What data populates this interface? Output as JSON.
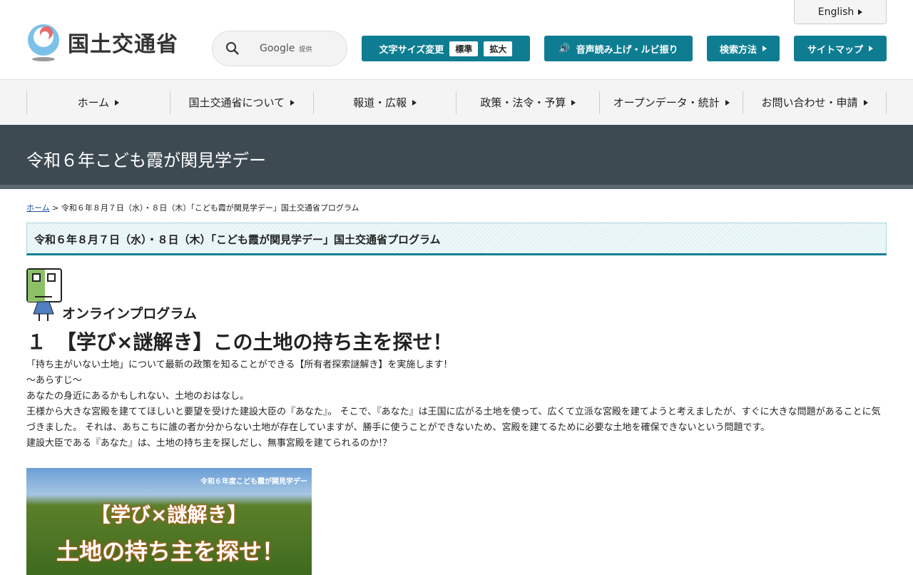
{
  "header": {
    "english": "English",
    "logo_text": "国土交通省",
    "search_brand": "Google",
    "search_provided": "提供",
    "font_size_label": "文字サイズ変更",
    "font_standard": "標準",
    "font_large": "拡大",
    "read_aloud": "音声読み上げ・ルビ振り",
    "search_method": "検索方法",
    "sitemap": "サイトマップ"
  },
  "nav": [
    "ホーム",
    "国土交通省について",
    "報道・広報",
    "政策・法令・予算",
    "オープンデータ・統計",
    "お問い合わせ・申請"
  ],
  "banner": "令和６年こども霞が関見学デー",
  "breadcrumb": {
    "home": "ホーム",
    "sep": " > ",
    "current": "令和６年８月７日（水）・８日（木）「こども霞が関見学デー」国土交通省プログラム"
  },
  "heading": "令和６年８月７日（水）・８日（木）「こども霞が関見学デー」国土交通省プログラム",
  "section": "オンラインプログラム",
  "program_title": "１　【学び×謎解き】この土地の持ち主を探せ！",
  "paragraphs": [
    "「持ち主がいない土地」について最新の政策を知ることができる【所有者探索謎解き】を実施します！",
    "～あらすじ～",
    "あなたの身近にあるかもしれない、土地のおはなし。",
    "王様から大きな宮殿を建ててほしいと要望を受けた建設大臣の『あなた』。 そこで、『あなた』は王国に広がる土地を使って、広くて立派な宮殿を建てようと考えましたが、すぐに大きな問題があることに気づきました。 それは、あちこちに誰の者か分からない土地が存在していますが、勝手に使うことができないため、宮殿を建てるために必要な土地を確保できないという問題です。",
    "建設大臣である『あなた』は、土地の持ち主を探しだし、無事宮殿を建てられるのか!？"
  ],
  "image": {
    "caption": "令和６年度こども霞が関見学デー",
    "line1": "【学び×謎解き】",
    "line2": "土地の持ち主を探せ！"
  }
}
